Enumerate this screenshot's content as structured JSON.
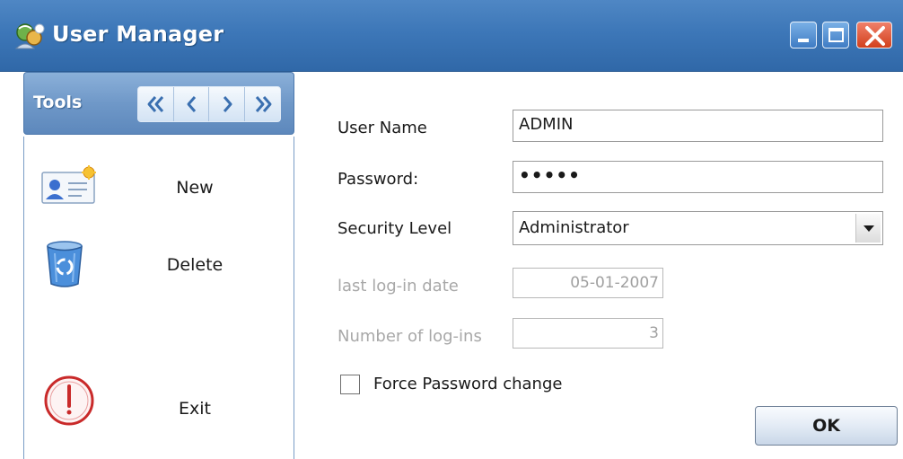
{
  "window": {
    "title": "User Manager",
    "app_icon": "user-manager-icon",
    "controls": [
      "minimize-icon",
      "maximize-icon",
      "close-icon"
    ]
  },
  "tools": {
    "title": "Tools",
    "nav_buttons": [
      "first-icon",
      "previous-icon",
      "next-icon",
      "last-icon"
    ],
    "items": [
      {
        "label": "New",
        "icon": "new-user-card-icon"
      },
      {
        "label": "Delete",
        "icon": "recycle-bin-icon"
      },
      {
        "label": "Exit",
        "icon": "power-icon"
      }
    ]
  },
  "form": {
    "user_name": {
      "label": "User Name",
      "value": "ADMIN"
    },
    "password": {
      "label": "Password:",
      "value": "•••••"
    },
    "security_level": {
      "label": "Security Level",
      "value": "Administrator"
    },
    "last_login": {
      "label": "last log-in date",
      "value": "05-01-2007"
    },
    "login_count": {
      "label": "Number of log-ins",
      "value": "3"
    },
    "force_password_change": {
      "label": "Force Password change",
      "checked": false
    },
    "ok_label": "OK"
  },
  "colors": {
    "titlebar": "#3d77b8",
    "tools_header": "#6f98c8",
    "close_button": "#d2401c",
    "disabled_text": "#a8a8a8"
  }
}
